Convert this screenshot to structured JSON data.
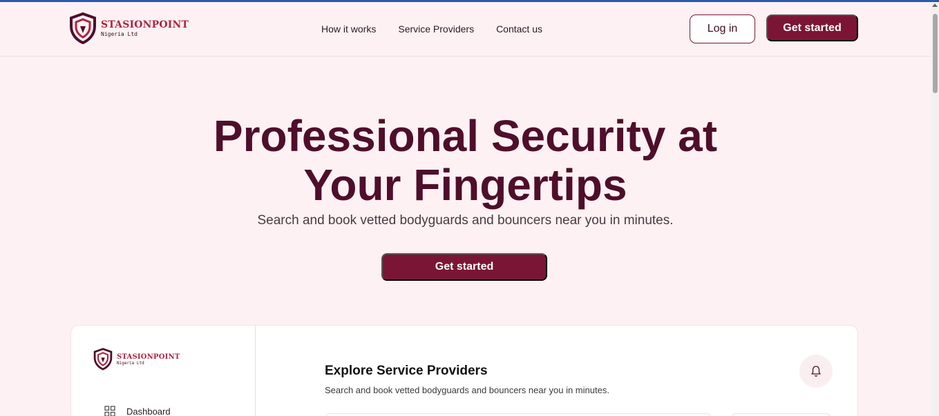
{
  "brand": {
    "name": "STASIONPOINT",
    "subtitle": "Nigeria Ltd",
    "color": "#b0243e"
  },
  "nav": {
    "links": [
      "How it works",
      "Service Providers",
      "Contact us"
    ],
    "login_label": "Log in",
    "cta_label": "Get started"
  },
  "hero": {
    "title_line1": "Professional Security at",
    "title_line2": "Your Fingertips",
    "subtitle": "Search and book vetted bodyguards and bouncers near you in minutes.",
    "cta_label": "Get started"
  },
  "dashboard_preview": {
    "sidebar": {
      "items": [
        {
          "label": "Dashboard",
          "icon": "grid-icon"
        }
      ]
    },
    "main": {
      "title": "Explore Service Providers",
      "subtitle": "Search and book vetted bodyguards and bouncers near you in minutes.",
      "notification_icon": "bell-icon"
    }
  },
  "colors": {
    "accent": "#7b1535",
    "background": "#fdf1f4",
    "heading": "#4f0e2a"
  }
}
